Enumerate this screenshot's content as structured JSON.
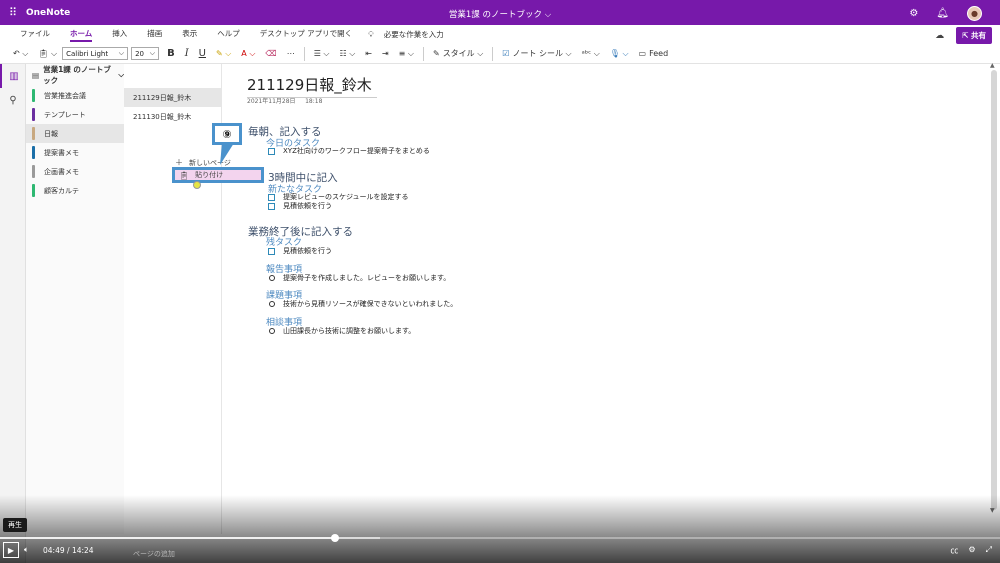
{
  "title_bar": {
    "app_name": "OneNote",
    "notebook_title": "営業1課 のノートブック",
    "chevron": "⌵",
    "icons": [
      "gear-icon",
      "bell-icon"
    ]
  },
  "menu": {
    "tabs": [
      {
        "label": "ファイル",
        "active": false
      },
      {
        "label": "ホーム",
        "active": true
      },
      {
        "label": "挿入",
        "active": false
      },
      {
        "label": "描画",
        "active": false
      },
      {
        "label": "表示",
        "active": false
      },
      {
        "label": "ヘルプ",
        "active": false
      },
      {
        "label": "デスクトップ アプリで開く",
        "active": false
      }
    ],
    "tell_me": "必要な作業を入力",
    "share": "共有"
  },
  "ribbon": {
    "font_name": "Calibri Light",
    "font_size": "20",
    "style_label": "スタイル",
    "note_tags_label": "ノート シール",
    "feed_label": "Feed"
  },
  "sections_pane": {
    "notebook_name": "営業1課 のノートブック",
    "sections": [
      {
        "label": "営業推進会議",
        "color": "#2eb872",
        "active": false
      },
      {
        "label": "テンプレート",
        "color": "#6b2fa0",
        "active": false
      },
      {
        "label": "日報",
        "color": "#c8a880",
        "active": true
      },
      {
        "label": "提案書メモ",
        "color": "#1b6fa8",
        "active": false
      },
      {
        "label": "企画書メモ",
        "color": "#9a9a9a",
        "active": false
      },
      {
        "label": "顧客カルテ",
        "color": "#2eb872",
        "active": false
      }
    ]
  },
  "pages_pane": {
    "pages": [
      {
        "label": "211129日報_鈴木",
        "active": true
      },
      {
        "label": "211130日報_鈴木",
        "active": false
      }
    ],
    "add_page": "ページの追加"
  },
  "context_menu": {
    "new_page": "新しいページ",
    "paste": "貼り付け"
  },
  "callout": {
    "label": "⑨"
  },
  "note": {
    "title": "211129日報_鈴木",
    "date": "2021年11月28日",
    "time": "18:18",
    "h_morning": "毎朝、記入する",
    "sub_today": "今日のタスク",
    "todo_1": "XYZ社向けのワークフロー提案骨子をまとめる",
    "h_hourly": "3時間中に記入",
    "sub_new": "新たなタスク",
    "todo_2": "提案レビューのスケジュールを設定する",
    "todo_3": "見積依頼を行う",
    "h_end": "業務終了後に記入する",
    "sub_remaining": "残タスク",
    "todo_4": "見積依頼を行う",
    "sub_report": "報告事項",
    "bullet_1": "提案骨子を作成しました。レビューをお願いします。",
    "sub_issues": "課題事項",
    "bullet_2": "技術から見積リソースが確保できないといわれました。",
    "sub_consult": "相談事項",
    "bullet_3": "山田課長から技術に調整をお願いします。"
  },
  "player": {
    "tooltip": "再生",
    "current_time": "04:49",
    "separator": "/",
    "total_time": "14:24",
    "progress_fraction": 0.335,
    "buffered_fraction": 0.38
  }
}
